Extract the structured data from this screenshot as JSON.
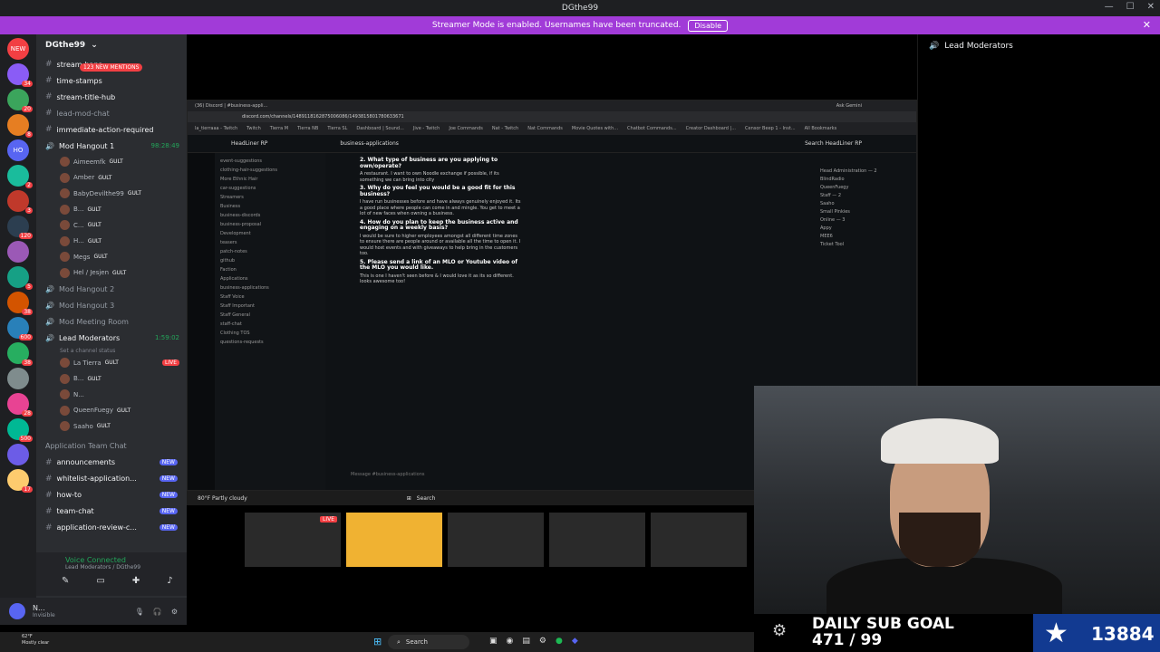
{
  "window": {
    "title": "DGthe99"
  },
  "banner": {
    "text": "Streamer Mode is enabled. Usernames have been truncated.",
    "button": "Disable"
  },
  "guilds": [
    {
      "label": "NEW",
      "badge": ""
    },
    {
      "label": "",
      "badge": "34"
    },
    {
      "label": "",
      "badge": "20"
    },
    {
      "label": "",
      "badge": "8"
    },
    {
      "label": "HO",
      "badge": ""
    },
    {
      "label": "",
      "badge": "2"
    },
    {
      "label": "",
      "badge": "3"
    },
    {
      "label": "",
      "badge": "120"
    },
    {
      "label": "",
      "badge": ""
    },
    {
      "label": "",
      "badge": "5"
    },
    {
      "label": "",
      "badge": "38"
    },
    {
      "label": "",
      "badge": "600"
    },
    {
      "label": "",
      "badge": "38"
    },
    {
      "label": "",
      "badge": ""
    },
    {
      "label": "",
      "badge": "28"
    },
    {
      "label": "",
      "badge": "500"
    },
    {
      "label": "",
      "badge": ""
    },
    {
      "label": "",
      "badge": "17"
    }
  ],
  "sidebar": {
    "server_name": "DGthe99",
    "mentions_badge": "123 NEW MENTIONS",
    "channels_top": [
      {
        "name": "stream-bans",
        "type": "text",
        "white": true
      },
      {
        "name": "time-stamps",
        "type": "text",
        "white": true
      },
      {
        "name": "stream-title-hub",
        "type": "text",
        "white": true
      },
      {
        "name": "lead-mod-chat",
        "type": "text",
        "white": false
      },
      {
        "name": "immediate-action-required",
        "type": "text",
        "white": true
      }
    ],
    "hangout1": {
      "name": "Mod Hangout 1",
      "time": "98:28:49"
    },
    "hangout1_users": [
      {
        "name": "Aimeemfk",
        "tag": "GULT"
      },
      {
        "name": "Amber",
        "tag": "GULT"
      },
      {
        "name": "BabyDevilthe99",
        "tag": "GULT"
      },
      {
        "name": "B...",
        "tag": "GULT"
      },
      {
        "name": "C...",
        "tag": "GULT"
      },
      {
        "name": "H...",
        "tag": "GULT"
      },
      {
        "name": "Megs",
        "tag": "GULT"
      },
      {
        "name": "Hel / Jesjen",
        "tag": "GULT"
      }
    ],
    "voice_channels": [
      "Mod Hangout 2",
      "Mod Hangout 3",
      "Mod Meeting Room"
    ],
    "lead_mods": {
      "name": "Lead Moderators",
      "time": "1:59:02",
      "status": "Set a channel status"
    },
    "lead_users": [
      {
        "name": "La Tierra",
        "tag": "GULT",
        "live": "LIVE"
      },
      {
        "name": "B...",
        "tag": "GULT",
        "live": ""
      },
      {
        "name": "N...",
        "tag": "",
        "live": ""
      },
      {
        "name": "QueenFuegy",
        "tag": "GULT",
        "live": ""
      },
      {
        "name": "Saaho",
        "tag": "GULT",
        "live": ""
      }
    ],
    "category": "Application Team Chat",
    "channels_bottom": [
      {
        "name": "announcements",
        "badge": "NEW"
      },
      {
        "name": "whitelist-application...",
        "badge": "NEW"
      },
      {
        "name": "how-to",
        "badge": "NEW"
      },
      {
        "name": "team-chat",
        "badge": "NEW"
      },
      {
        "name": "application-review-c...",
        "badge": "NEW"
      }
    ]
  },
  "voice": {
    "status": "Voice Connected",
    "channel": "Lead Moderators / DGthe99"
  },
  "user": {
    "name": "N...",
    "status": "Invisible"
  },
  "right_panel": {
    "title": "Lead Moderators"
  },
  "browser": {
    "tab": "(36) Discord | #business-appli...",
    "ask": "Ask Gemini",
    "url": "discord.com/channels/1489118162875006086/1493815801780633671",
    "bookmarks": [
      "la_tierraaa - Twitch",
      "Twitch",
      "Tierra M",
      "Tierra NB",
      "Tierra SL",
      "Dashboard | Sound...",
      "Jive - Twitch",
      "Joe Commands",
      "Nat - Twitch",
      "Nat Commands",
      "Movie Quotes with...",
      "Chatbot Commands...",
      "Creator Dashboard |...",
      "Censor Beep 1 - Inst...",
      "All Bookmarks"
    ]
  },
  "discord_inner": {
    "server": "HeadLiner RP",
    "channel": "business-applications",
    "search": "Search HeadLiner RP",
    "channels": [
      "event-suggestions",
      "clothing-hair-suggestions",
      "More Ethnic Hair",
      "car-suggestions",
      "Streamers",
      "Business",
      "business-discords",
      "business-proposal",
      "Development",
      "teasers",
      "patch-notes",
      "github",
      "Faction",
      "Applications",
      "business-applications",
      "Staff Voice",
      "Staff Important",
      "Staff General",
      "staff-chat",
      "Clothing TOS",
      "questions-requests"
    ],
    "q2": "2. What type of business are you applying to own/operate?",
    "a2": "A restaurant. I want to own Noodle exchange if possible, if its something we can bring into city",
    "q3": "3. Why do you feel you would be a good fit for this business?",
    "a3": "I have run businesses before and have always genuinely enjoyed it. Its a good place where people can come in and mingle. You get to meet a lot of new faces when owning a business.",
    "q4": "4. How do you plan to keep the business active and engaging on a weekly basis?",
    "a4": "I would be sure to higher employees amongst all different time zones to ensure there are people around or available all the time to open it. I would host events and with giveaways to help bring in the customers too.",
    "q5": "5. Please send a link of an MLO or Youtube video of the MLO you would like.",
    "a5": "This is one I haven't seen before & I would love it as its so different. looks awesome too!",
    "input": "Message #business-applications",
    "members_head": "Head Administration — 2",
    "members": [
      "BlindRadio",
      "QueenFuegy",
      "Staff — 2",
      "Saaho",
      "Small Pinkies",
      "Online — 3",
      "Appy",
      "MEE6",
      "Ticket Tool"
    ]
  },
  "inner_taskbar": {
    "weather": "80°F Partly cloudy",
    "search": "Search"
  },
  "stream_thumbs": [
    {
      "live": "LIVE"
    },
    {
      "live": ""
    },
    {
      "live": ""
    },
    {
      "live": ""
    },
    {
      "live": ""
    }
  ],
  "sub_goal": {
    "title": "DAILY SUB GOAL",
    "progress": "471 / 99",
    "count": "13884"
  },
  "taskbar": {
    "weather_temp": "62°F",
    "weather_desc": "Mostly clear",
    "search": "Search"
  }
}
